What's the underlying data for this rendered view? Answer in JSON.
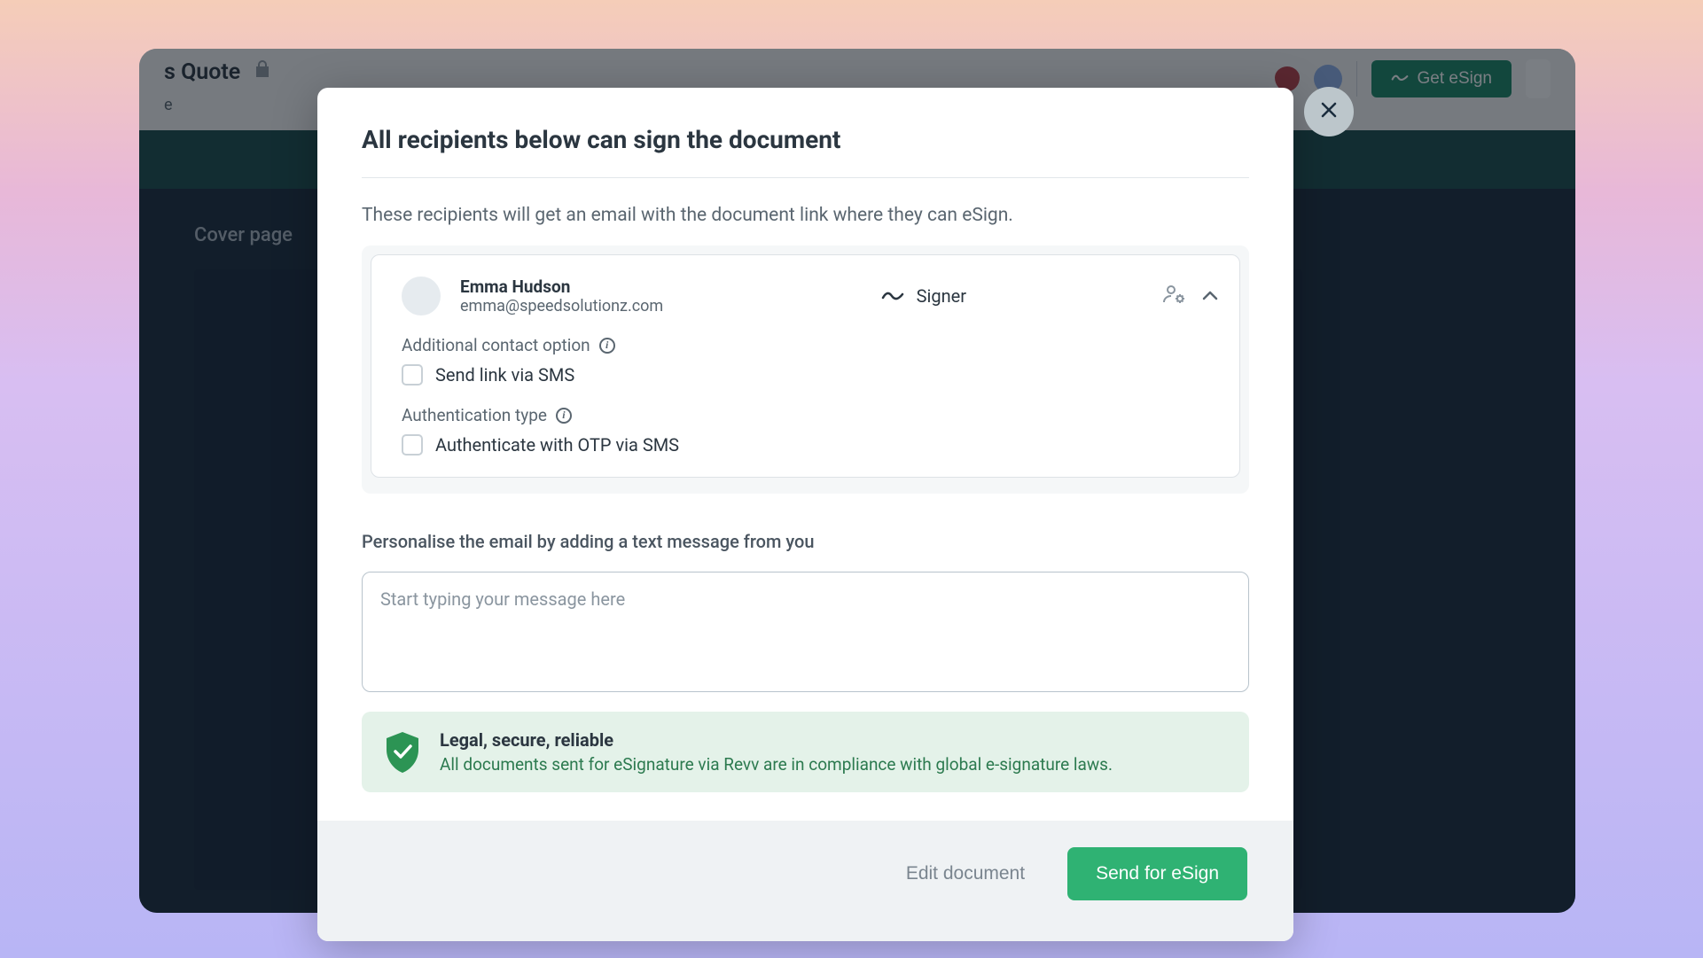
{
  "backdrop": {
    "title": "s Quote",
    "subtitle_fragment": "e",
    "cover_page": "Cover page",
    "get_esign": "Get eSign"
  },
  "modal": {
    "title": "All recipients below can sign the document",
    "description": "These recipients will get an email with the document link where they can eSign.",
    "recipient": {
      "name": "Emma Hudson",
      "email": "emma@speedsolutionz.com",
      "role": "Signer"
    },
    "additional_contact_label": "Additional contact option",
    "sms_checkbox_label": "Send link via SMS",
    "auth_type_label": "Authentication type",
    "otp_checkbox_label": "Authenticate with OTP via SMS",
    "personalise_label": "Personalise the email by adding a text message from you",
    "message_placeholder": "Start typing your message here",
    "trust": {
      "title": "Legal, secure, reliable",
      "description": "All documents sent for eSignature via Revv are in compliance with global e-signature laws."
    },
    "footer": {
      "edit": "Edit document",
      "send": "Send for eSign"
    }
  }
}
